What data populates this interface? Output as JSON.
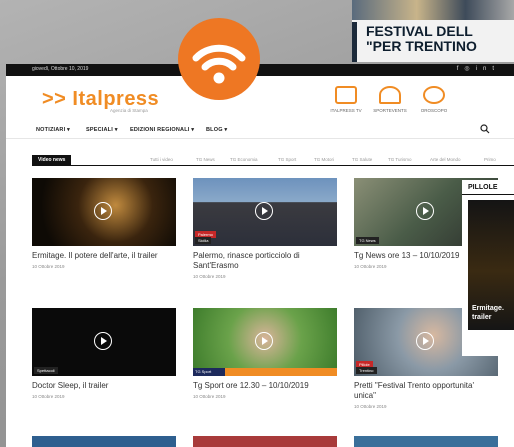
{
  "news_card": {
    "line1": "FESTIVAL DELL",
    "line2": "\"PER TRENTINO"
  },
  "topbar": {
    "date": "giovedì, Ottobre 10, 2019",
    "social_icons": [
      "facebook-icon",
      "instagram-icon",
      "linkedin-icon",
      "twitter-icon"
    ]
  },
  "site": {
    "logo": ">> Italpress",
    "tagline": "Agenzia di Stampa"
  },
  "header_icons": [
    {
      "name": "italpress-tv",
      "label": "ITALPRESS TV"
    },
    {
      "name": "sportevents",
      "label": "SPORTEVENTS"
    },
    {
      "name": "oroscopo",
      "label": "OROSCOPO"
    }
  ],
  "nav": {
    "items": [
      "NOTIZIARI ▾",
      "SPECIALI ▾",
      "EDIZIONI REGIONALI ▾",
      "BLOG ▾"
    ]
  },
  "video_tabs": {
    "active": "Video news",
    "items": [
      "Tutti i video",
      "TG News",
      "TG Economia",
      "TG Sport",
      "TG Motori",
      "TG Salute",
      "TG Turismo",
      "Arte del Mondo",
      "Primo"
    ]
  },
  "cards": [
    {
      "title": "Ermitage. Il potere dell'arte, il trailer",
      "date": "10 Ottobre 2019",
      "thumb_bg": "#2b1d0e"
    },
    {
      "title": "Palermo, rinasce porticciolo di Sant'Erasmo",
      "date": "10 Ottobre 2019",
      "thumb_bg": "#5b7fa8",
      "tag": "Palermo",
      "tag2": "Sicilia"
    },
    {
      "title": "Tg News ore 13 – 10/10/2019",
      "date": "10 Ottobre 2019",
      "thumb_bg": "#4a5c48",
      "tag2": "TG News"
    },
    {
      "title": "Doctor Sleep, il trailer",
      "date": "10 Ottobre 2019",
      "thumb_bg": "#0d0d0d",
      "tag2": "Spettacoli"
    },
    {
      "title": "Tg Sport ore 12.30 – 10/10/2019",
      "date": "10 Ottobre 2019",
      "thumb_bg": "#4e9a3c",
      "ticker": "TG Sport"
    },
    {
      "title": "Pretti \"Festival Trento opportunita' unica\"",
      "date": "10 Ottobre 2019",
      "thumb_bg": "#6f7f8a",
      "tag": "Pillole",
      "tag2": "Trentino"
    }
  ],
  "pillole": {
    "heading": "PILLOLE",
    "text_line1": "Ermitage.",
    "text_line2": "trailer"
  },
  "rss_badge": {
    "icon": "rss-icon",
    "color": "#ee7723"
  }
}
